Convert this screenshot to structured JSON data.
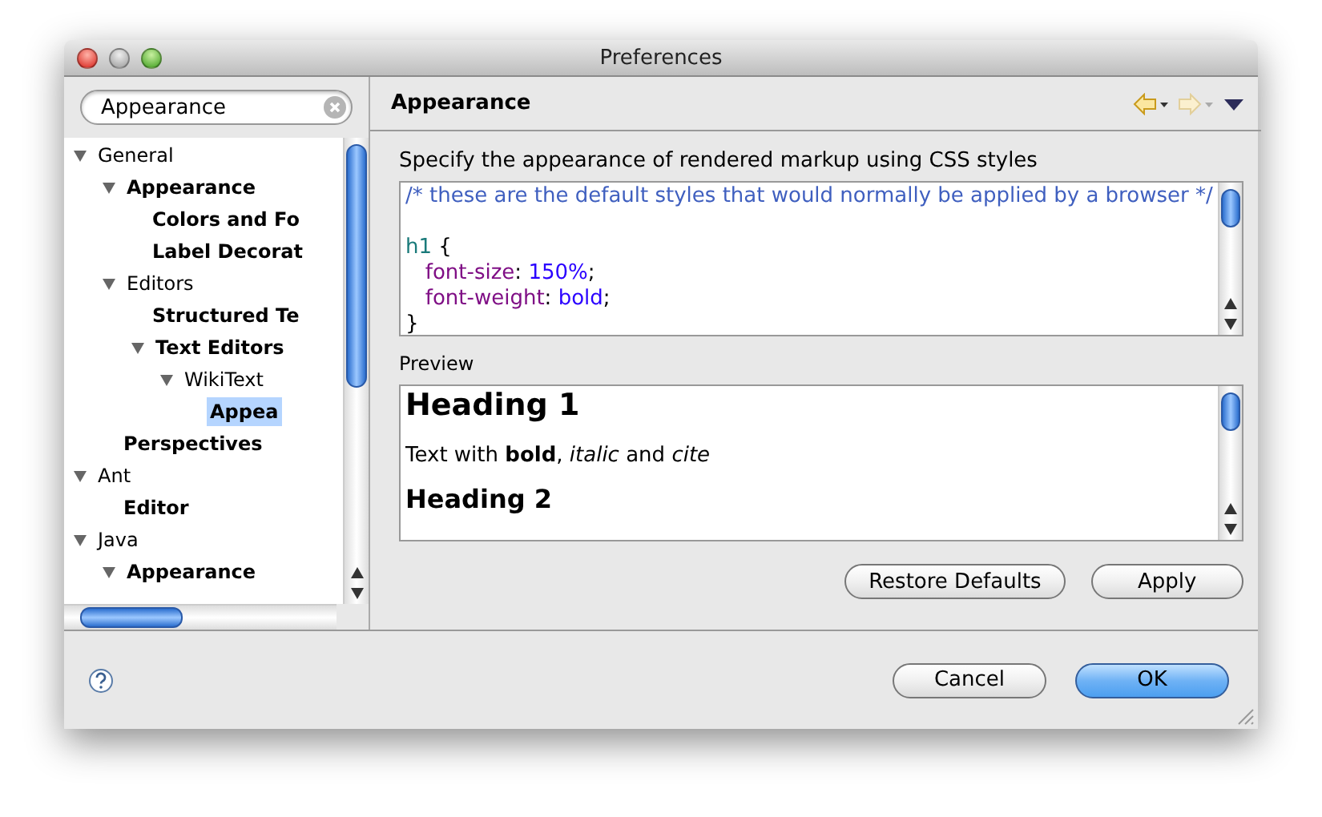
{
  "window": {
    "title": "Preferences"
  },
  "filter": {
    "value": "Appearance"
  },
  "tree": [
    {
      "label": "General",
      "bold": false,
      "selected": false,
      "expanded": true,
      "children": [
        {
          "label": "Appearance",
          "bold": true,
          "selected": false,
          "expanded": true,
          "children": [
            {
              "label": "Colors and Fo",
              "bold": true,
              "selected": false
            },
            {
              "label": "Label Decorat",
              "bold": true,
              "selected": false
            }
          ]
        },
        {
          "label": "Editors",
          "bold": false,
          "selected": false,
          "expanded": true,
          "children": [
            {
              "label": "Structured Te",
              "bold": true,
              "selected": false
            },
            {
              "label": "Text Editors",
              "bold": true,
              "selected": false,
              "expanded": true,
              "children": [
                {
                  "label": "WikiText",
                  "bold": false,
                  "selected": false,
                  "expanded": true,
                  "children": [
                    {
                      "label": "Appea",
                      "bold": true,
                      "selected": true
                    }
                  ]
                }
              ]
            }
          ]
        },
        {
          "label": "Perspectives",
          "bold": true,
          "selected": false
        }
      ]
    },
    {
      "label": "Ant",
      "bold": false,
      "selected": false,
      "expanded": true,
      "children": [
        {
          "label": "Editor",
          "bold": true,
          "selected": false
        }
      ]
    },
    {
      "label": "Java",
      "bold": false,
      "selected": false,
      "expanded": true,
      "children": [
        {
          "label": "Appearance",
          "bold": true,
          "selected": false,
          "expanded": true
        }
      ]
    }
  ],
  "page": {
    "title": "Appearance",
    "description": "Specify the appearance of rendered markup using CSS styles",
    "css_lines": [
      [
        {
          "text": "/* these are the default styles that would normally be applied by a browser */",
          "kind": "comment",
          "blank_line_after": true
        }
      ],
      [
        {
          "text": "h1",
          "kind": "selector"
        },
        {
          "text": " {",
          "kind": "punct"
        }
      ],
      [
        {
          "text": "   font-size",
          "kind": "property"
        },
        {
          "text": ": ",
          "kind": "punct"
        },
        {
          "text": "150%",
          "kind": "value"
        },
        {
          "text": ";",
          "kind": "punct"
        }
      ],
      [
        {
          "text": "   font-weight",
          "kind": "property"
        },
        {
          "text": ": ",
          "kind": "punct"
        },
        {
          "text": "bold",
          "kind": "value"
        },
        {
          "text": ";",
          "kind": "punct"
        }
      ],
      [
        {
          "text": "}",
          "kind": "punct"
        }
      ]
    ],
    "preview_label": "Preview",
    "preview": [
      {
        "kind": "h1",
        "text": "Heading 1"
      },
      {
        "kind": "p",
        "text": "Text with **bold**, *italic* and *cite*"
      },
      {
        "kind": "h2",
        "text": "Heading 2"
      }
    ],
    "buttons": [
      "Restore Defaults",
      "Apply"
    ]
  },
  "footer": {
    "buttons": [
      {
        "label": "Cancel",
        "default": false
      },
      {
        "label": "OK",
        "default": true
      }
    ]
  }
}
